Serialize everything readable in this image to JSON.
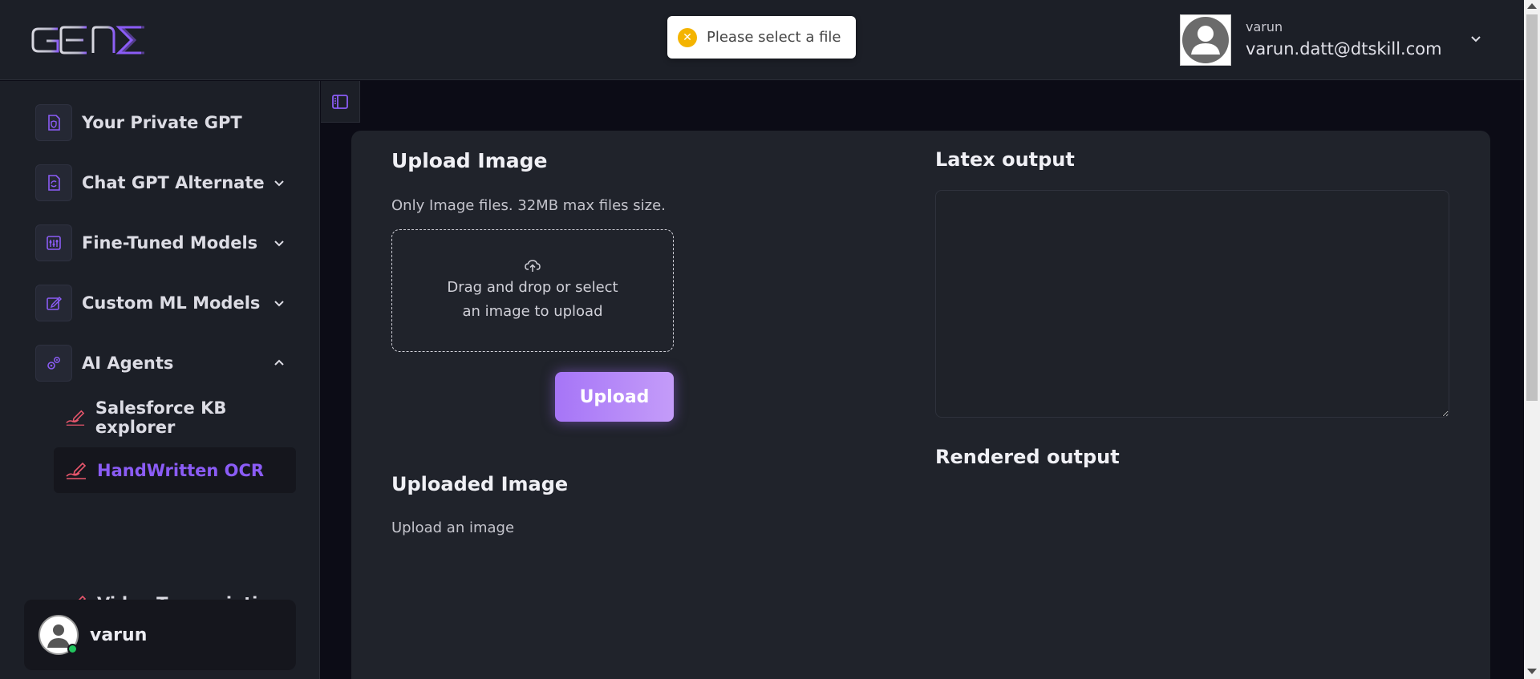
{
  "app": {
    "logo_alt": "GENE"
  },
  "toast": {
    "message": "Please select a file",
    "icon": "error-x-icon",
    "icon_color": "#f4b400"
  },
  "user": {
    "name": "varun",
    "email": "varun.datt@dtskill.com"
  },
  "sidebar": {
    "items": [
      {
        "label": "Your Private GPT",
        "icon": "shield-doc-icon"
      },
      {
        "label": "Chat GPT Alternate",
        "icon": "refresh-doc-icon"
      },
      {
        "label": "Fine-Tuned Models",
        "icon": "sliders-icon"
      },
      {
        "label": "Custom ML Models",
        "icon": "edit-doc-icon"
      },
      {
        "label": "AI Agents",
        "icon": "gears-icon"
      }
    ],
    "sub_items": [
      {
        "label": "Salesforce KB explorer",
        "icon": "handwriting-icon"
      },
      {
        "label": "HandWritten OCR",
        "icon": "handwriting-icon"
      },
      {
        "label": "Video Transcription",
        "icon": "handwriting-icon"
      }
    ],
    "profile": {
      "name": "varun"
    }
  },
  "main": {
    "upload": {
      "title": "Upload Image",
      "hint": "Only Image files. 32MB max files size.",
      "dropzone_text": "Drag and drop or select an image to upload",
      "button": "Upload"
    },
    "uploaded": {
      "title": "Uploaded Image",
      "empty_text": "Upload an image"
    },
    "latex": {
      "title": "Latex output",
      "value": ""
    },
    "rendered": {
      "title": "Rendered output"
    }
  },
  "colors": {
    "accent": "#8b5cf6",
    "background": "#0c0c16",
    "panel": "#1c1f27",
    "card": "#20232b"
  }
}
